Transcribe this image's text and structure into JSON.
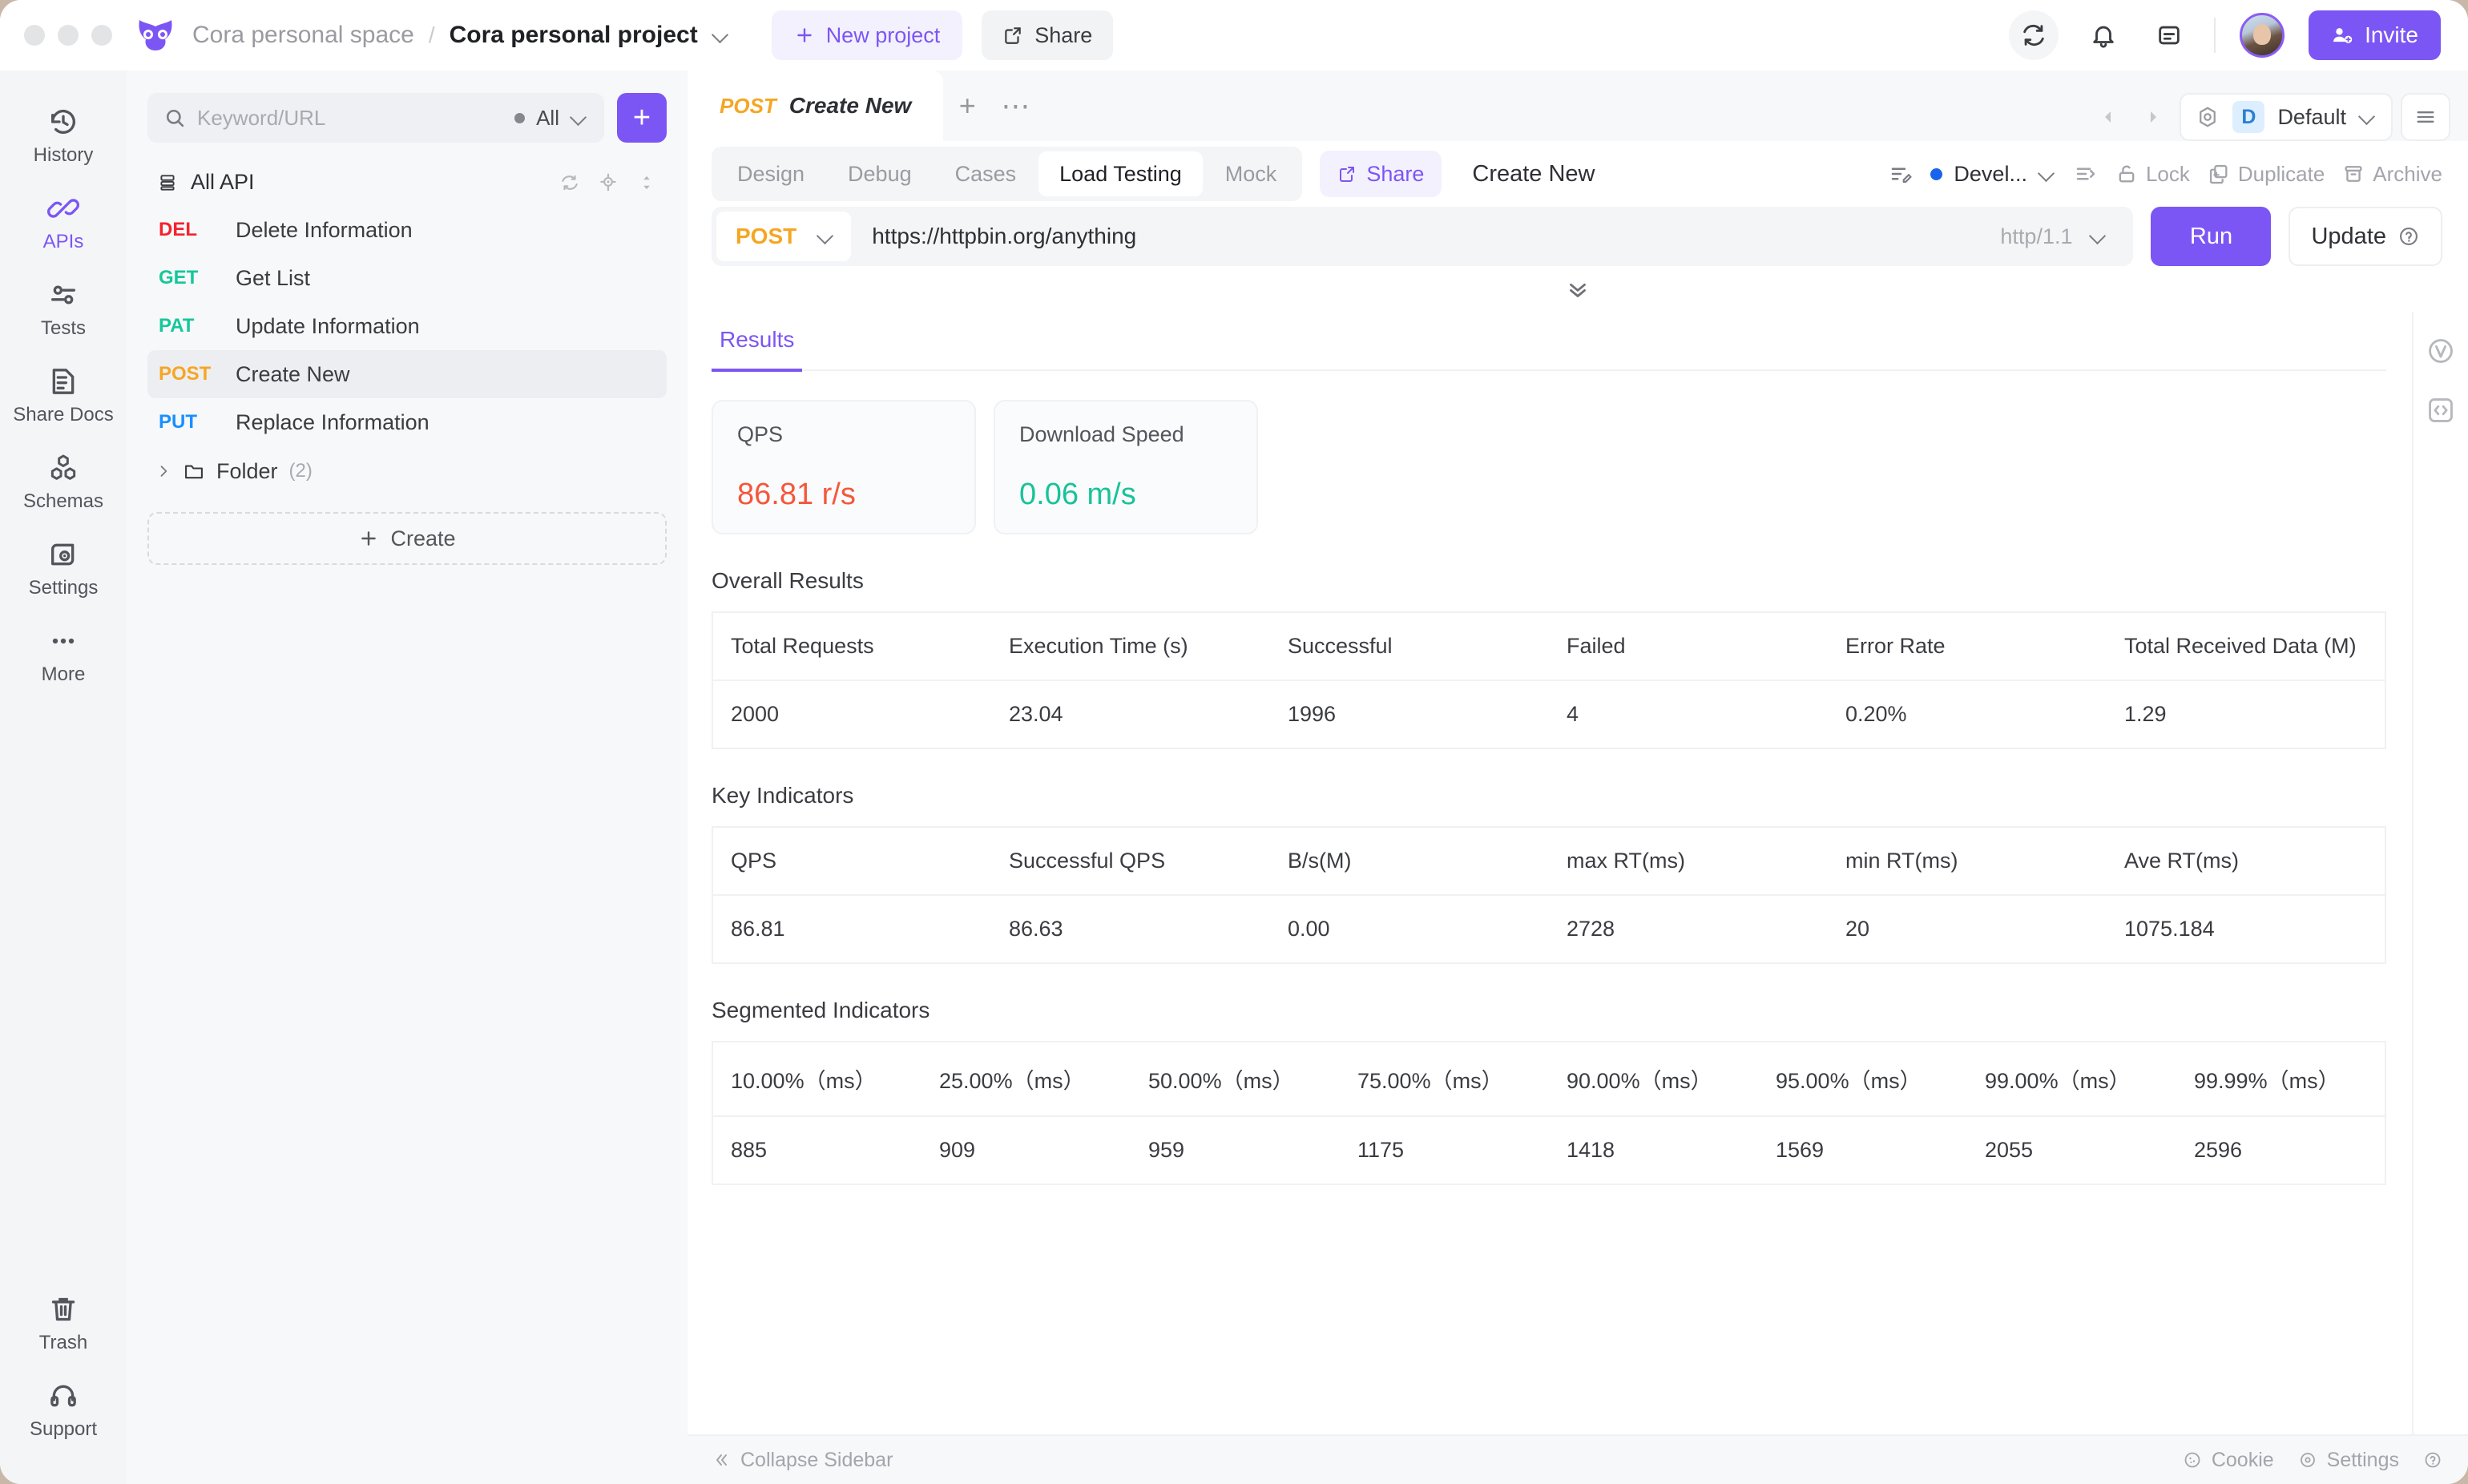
{
  "titlebar": {
    "breadcrumb_space": "Cora personal space",
    "breadcrumb_sep": "/",
    "breadcrumb_project": "Cora personal project",
    "new_project_label": "New project",
    "share_label": "Share",
    "invite_label": "Invite"
  },
  "rail": {
    "items": [
      {
        "label": "History",
        "icon": "history-icon",
        "active": false
      },
      {
        "label": "APIs",
        "icon": "api-link-icon",
        "active": true
      },
      {
        "label": "Tests",
        "icon": "tests-icon",
        "active": false
      },
      {
        "label": "Share Docs",
        "icon": "share-docs-icon",
        "active": false
      },
      {
        "label": "Schemas",
        "icon": "schemas-icon",
        "active": false
      },
      {
        "label": "Settings",
        "icon": "settings-eye-icon",
        "active": false
      },
      {
        "label": "More",
        "icon": "more-dots-icon",
        "active": false
      }
    ],
    "bottom": [
      {
        "label": "Trash",
        "icon": "trash-icon"
      },
      {
        "label": "Support",
        "icon": "headset-icon"
      }
    ]
  },
  "apilist": {
    "search_placeholder": "Keyword/URL",
    "search_value": "",
    "filter_label": "All",
    "add_label": "+",
    "all_api_label": "All API",
    "nodes": [
      {
        "method": "DEL",
        "method_class": "mth-del",
        "name": "Delete Information",
        "selected": false
      },
      {
        "method": "GET",
        "method_class": "mth-get",
        "name": "Get List",
        "selected": false
      },
      {
        "method": "PAT",
        "method_class": "mth-pat",
        "name": "Update Information",
        "selected": false
      },
      {
        "method": "POST",
        "method_class": "mth-post",
        "name": "Create New",
        "selected": true
      },
      {
        "method": "PUT",
        "method_class": "mth-put",
        "name": "Replace Information",
        "selected": false
      }
    ],
    "folder_label": "Folder",
    "folder_count": "(2)",
    "create_label": "Create"
  },
  "tabs": {
    "active_method": "POST",
    "active_title": "Create New",
    "add_tab": "+",
    "more_tabs": "⋯",
    "env_badge": "D",
    "env_name": "Default"
  },
  "request": {
    "subtabs": [
      {
        "label": "Design",
        "active": false
      },
      {
        "label": "Debug",
        "active": false
      },
      {
        "label": "Cases",
        "active": false
      },
      {
        "label": "Load Testing",
        "active": true
      },
      {
        "label": "Mock",
        "active": false
      }
    ],
    "share_label": "Share",
    "name_value": "Create New",
    "status_label": "Devel...",
    "lock_label": "Lock",
    "duplicate_label": "Duplicate",
    "archive_label": "Archive",
    "method": "POST",
    "url": "https://httpbin.org/anything",
    "protocol": "http/1.1",
    "run_label": "Run",
    "update_label": "Update"
  },
  "results": {
    "tab_label": "Results",
    "cards": [
      {
        "label": "QPS",
        "value": "86.81 r/s",
        "color_class": "red"
      },
      {
        "label": "Download Speed",
        "value": "0.06 m/s",
        "color_class": "green"
      }
    ],
    "overall": {
      "title": "Overall Results",
      "headers": [
        "Total Requests",
        "Execution Time (s)",
        "Successful",
        "Failed",
        "Error Rate",
        "Total Received Data (M)"
      ],
      "rows": [
        [
          "2000",
          "23.04",
          "1996",
          "4",
          "0.20%",
          "1.29"
        ]
      ]
    },
    "key_indicators": {
      "title": "Key Indicators",
      "headers": [
        "QPS",
        "Successful QPS",
        "B/s(M)",
        "max RT(ms)",
        "min RT(ms)",
        "Ave RT(ms)"
      ],
      "rows": [
        [
          "86.81",
          "86.63",
          "0.00",
          "2728",
          "20",
          "1075.184"
        ]
      ]
    },
    "segmented": {
      "title": "Segmented Indicators",
      "headers": [
        "10.00%（ms）",
        "25.00%（ms）",
        "50.00%（ms）",
        "75.00%（ms）",
        "90.00%（ms）",
        "95.00%（ms）",
        "99.00%（ms）",
        "99.99%（ms）"
      ],
      "rows": [
        [
          "885",
          "909",
          "959",
          "1175",
          "1418",
          "1569",
          "2055",
          "2596"
        ]
      ]
    }
  },
  "statusbar": {
    "collapse_label": "Collapse Sidebar",
    "cookie_label": "Cookie",
    "settings_label": "Settings"
  }
}
